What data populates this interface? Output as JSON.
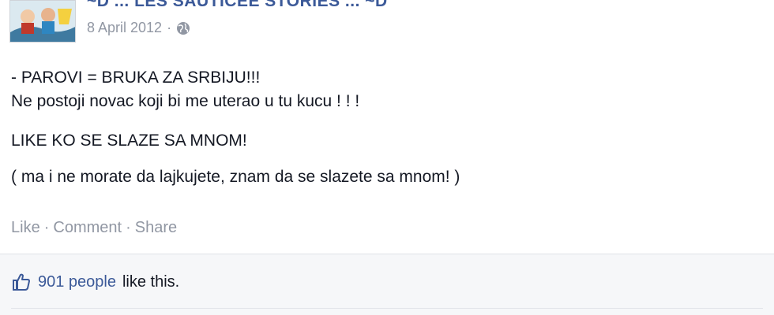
{
  "post": {
    "author": "~D ... LES SAUTICEE STORIES ... ~D",
    "date": "8 April 2012",
    "privacy_icon": "globe-icon",
    "lines": [
      "- PAROVI = BRUKA ZA SRBIJU!!!",
      "Ne postoji novac koji bi me uterao u tu kucu ! ! !",
      "LIKE KO SE SLAZE SA MNOM!",
      "( ma i ne morate da lajkujete, znam da se slazete sa mnom! )"
    ],
    "actions": {
      "like": "Like",
      "comment": "Comment",
      "share": "Share",
      "separator": "·"
    }
  },
  "likes": {
    "icon": "thumbs-up-icon",
    "count_text": "901 people",
    "suffix": "like this."
  },
  "colors": {
    "link": "#3b5998",
    "muted": "#9197a3",
    "text": "#141823",
    "panel": "#f6f7f9"
  }
}
